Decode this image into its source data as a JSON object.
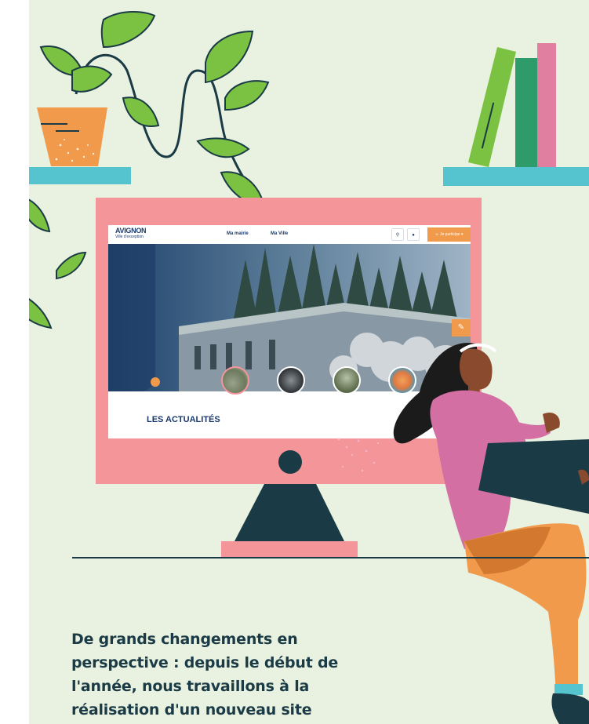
{
  "website": {
    "logo_text": "AVIGNON",
    "logo_tagline": "Ville d'exception",
    "nav_items": [
      "Ma mairie",
      "Ma Ville"
    ],
    "search_icon": "search-icon",
    "location_icon": "location-pin-icon",
    "account_label": "Je participe",
    "edit_icon": "pencil-icon",
    "section_title": "LES ACTUALITÉS"
  },
  "article": {
    "headline": "De grands changements en perspective : depuis le début de l'année, nous travaillons à la réalisation d'un nouveau site Internet"
  },
  "colors": {
    "background": "#e9f1e1",
    "monitor": "#f4959a",
    "shelf": "#55c4cf",
    "ink": "#1a3b45",
    "accent_orange": "#f19a4b",
    "leaf_green": "#7cc242",
    "site_blue": "#1b3a6b"
  }
}
